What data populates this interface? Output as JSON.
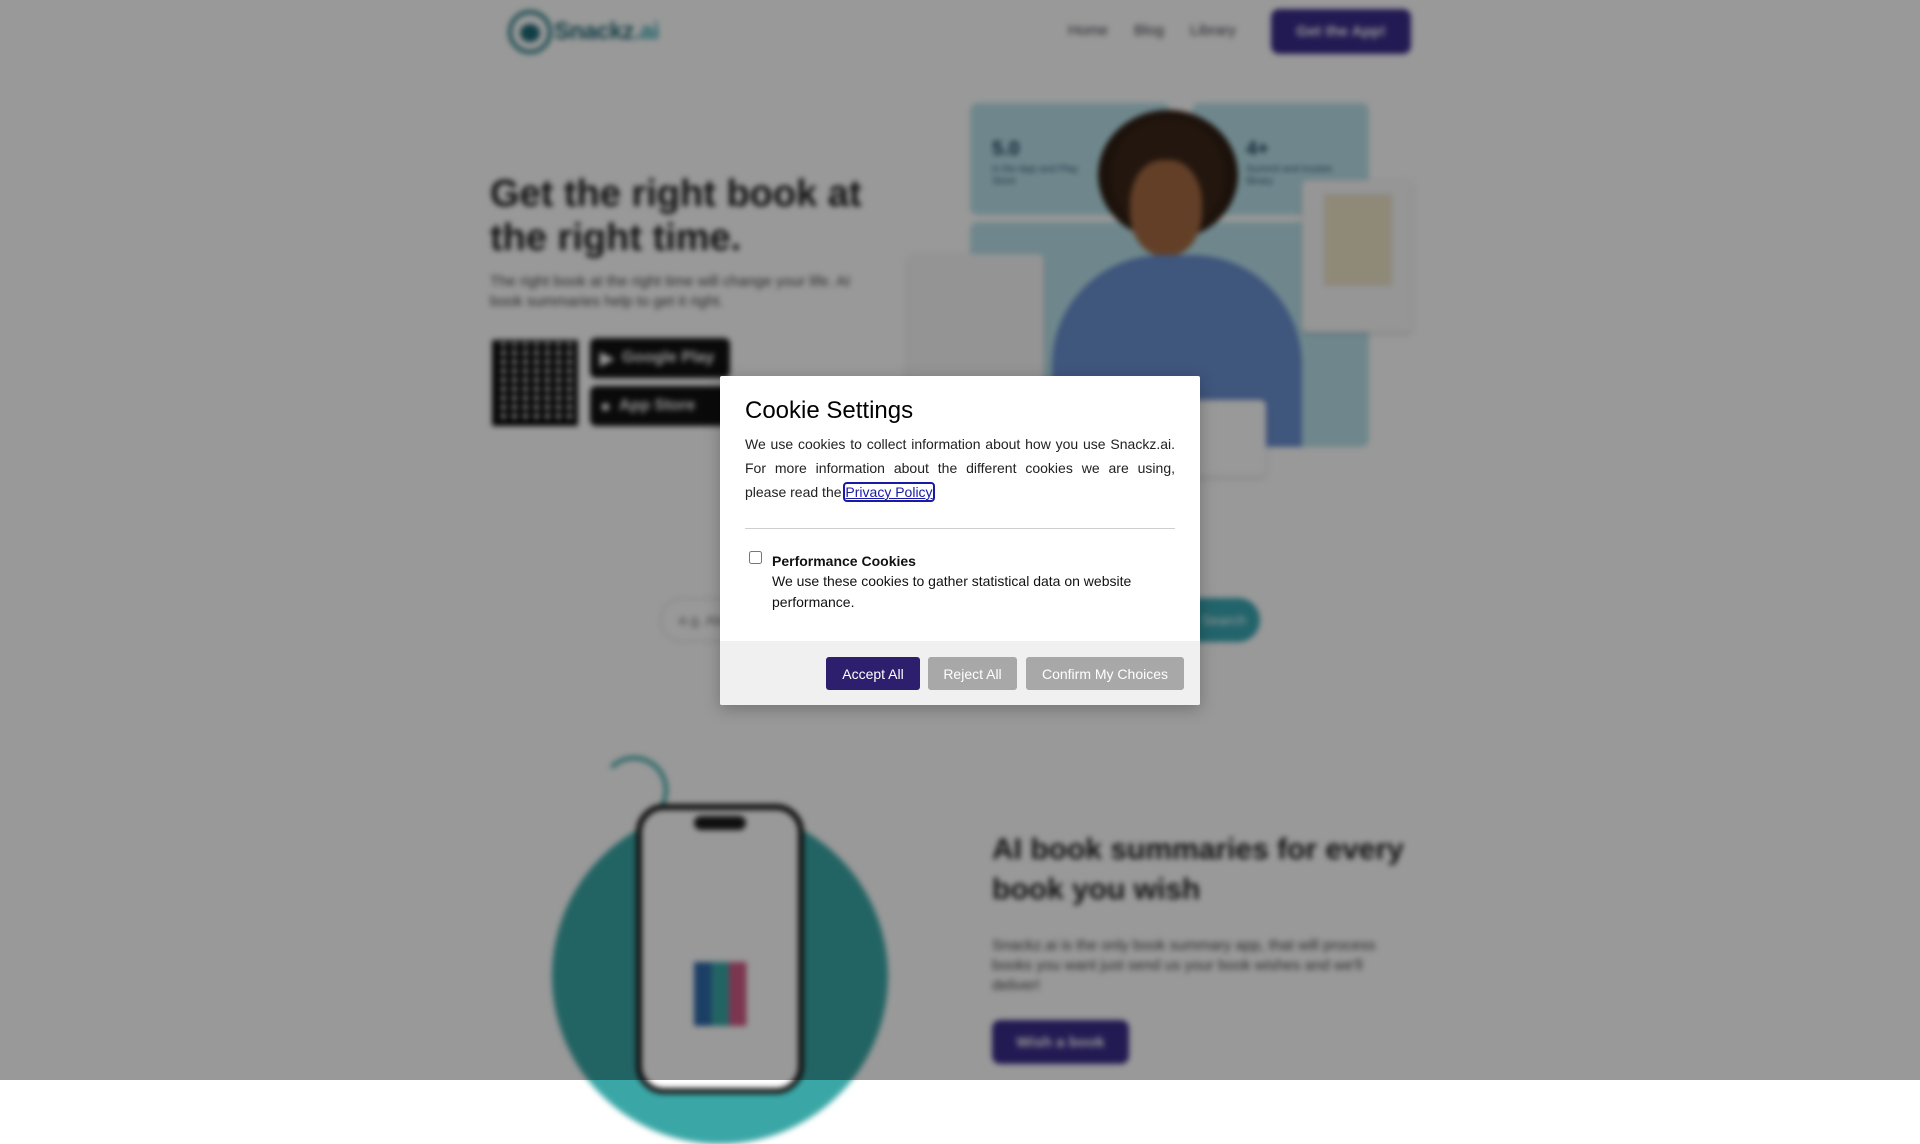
{
  "site": {
    "logo_text": "Snackz",
    "logo_suffix": ".ai",
    "nav": [
      "Home",
      "Blog",
      "Library"
    ],
    "cta": "Get the App!"
  },
  "hero": {
    "title": "Get the right book at the right time.",
    "subtitle": "The right book at the right time will change your life. AI book summaries help to get it right.",
    "store_google": "Google Play",
    "store_apple": "App Store",
    "rating_a": "5.0",
    "rating_a_sub": "in the App and Play Store",
    "rating_b": "4+",
    "rating_b_sub": "Summit and trustee library"
  },
  "search": {
    "placeholder": "e.g. Atomic Habits",
    "button": "Search"
  },
  "section": {
    "title": "AI book summaries for every book you wish",
    "text": "Snackz.ai is the only book summary app, that will process books you want just send us your book wishes and we'll deliver!",
    "button": "Wish a book"
  },
  "cookie": {
    "title": "Cookie Settings",
    "description": "We use cookies to collect information about how you use Snackz.ai. For more information about the different cookies we are using, please read the",
    "privacy_link": "Privacy Policy",
    "option_title": "Performance Cookies",
    "option_desc": "We use these cookies to gather statistical data on website performance.",
    "option_checked": false,
    "accept_label": "Accept All",
    "reject_label": "Reject All",
    "confirm_label": "Confirm My Choices"
  },
  "colors": {
    "brand_purple": "#2e1f6e",
    "brand_teal": "#3aa7b3",
    "disabled_gray": "#a8a8a8"
  }
}
